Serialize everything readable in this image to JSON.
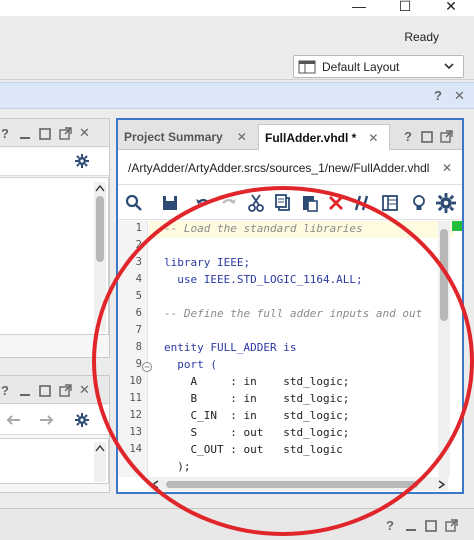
{
  "window": {
    "minimize_glyph": "—",
    "maximize_glyph": "☐",
    "close_glyph": "✕"
  },
  "status": {
    "text": "Ready"
  },
  "layout_select": {
    "value": "Default Layout"
  },
  "panel_controls": {
    "help": "?",
    "close": "✕"
  },
  "editor": {
    "tabs": [
      {
        "label": "Project Summary",
        "close": "✕"
      },
      {
        "label": "FullAdder.vhdl *",
        "close": "✕"
      }
    ],
    "path": "/ArtyAdder/ArtyAdder.srcs/sources_1/new/FullAdder.vhdl",
    "line_numbers": [
      "1",
      "2",
      "3",
      "4",
      "5",
      "6",
      "7",
      "8",
      "9",
      "10",
      "11",
      "12",
      "13",
      "14"
    ],
    "lines": [
      "-- Load the standard libraries",
      "",
      "library IEEE;",
      "  use IEEE.STD_LOGIC_1164.ALL;",
      "",
      "-- Define the full adder inputs and out",
      "",
      "entity FULL_ADDER is",
      "  port (",
      "    A     : in    std_logic;",
      "    B     : in    std_logic;",
      "    C_IN  : in    std_logic;",
      "    S     : out   std_logic;",
      "    C_OUT : out   std_logic",
      "  );"
    ]
  },
  "colors": {
    "accent": "#3b78c9",
    "annotation": "#e0262b",
    "current_line": "#fffbe0"
  }
}
